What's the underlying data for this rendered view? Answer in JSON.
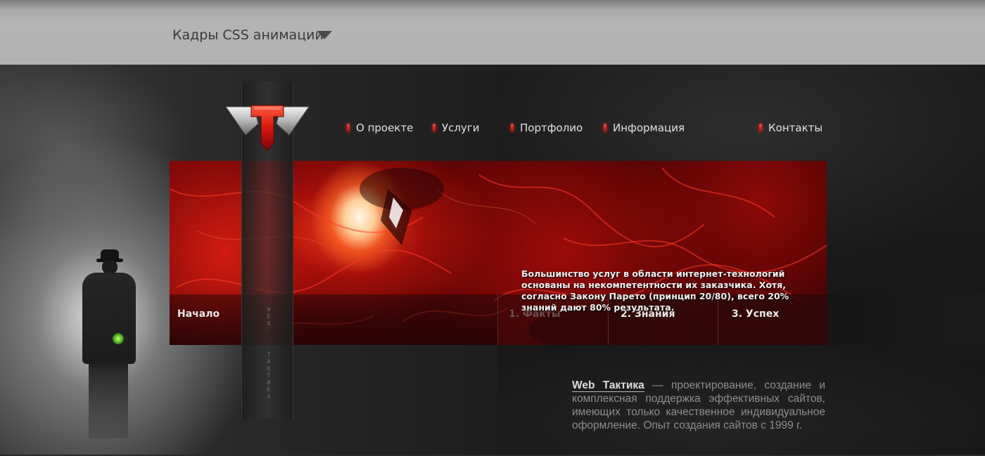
{
  "topbar": {
    "title": "Кадры CSS анимации",
    "dropdown_icon": "triangle-down-icon"
  },
  "logo": {
    "icon": "tactics-t-logo-icon",
    "colors": {
      "red": "#d6170f",
      "silver": "#c8c8c8"
    }
  },
  "nav": {
    "items": [
      {
        "label": "О проекте"
      },
      {
        "label": "Услуги"
      },
      {
        "label": "Портфолио"
      },
      {
        "label": "Информация"
      },
      {
        "label": "Контакты"
      }
    ]
  },
  "column": {
    "web": "W E B",
    "tactics": "Т А К Т И К А"
  },
  "banner": {
    "text": "Большинство услуг в области интернет-технологий основаны на некомпетентности их заказчика. Хотя, согласно Закону Парето (принцип 20/80), всего 20% знаний дают 80% результата.",
    "accent_color": "#c4100b"
  },
  "tabs": {
    "start": "Начало",
    "facts": "1. Факты",
    "knowledge": "2. Знания",
    "success": "3. Успех"
  },
  "about": {
    "brand": "Web Тактика",
    "text": " — проектирование, создание и комплексная поддержка эффективных сайтов, имеющих только качественное индивидуальное оформление. Опыт создания сайтов с 1999 г."
  }
}
